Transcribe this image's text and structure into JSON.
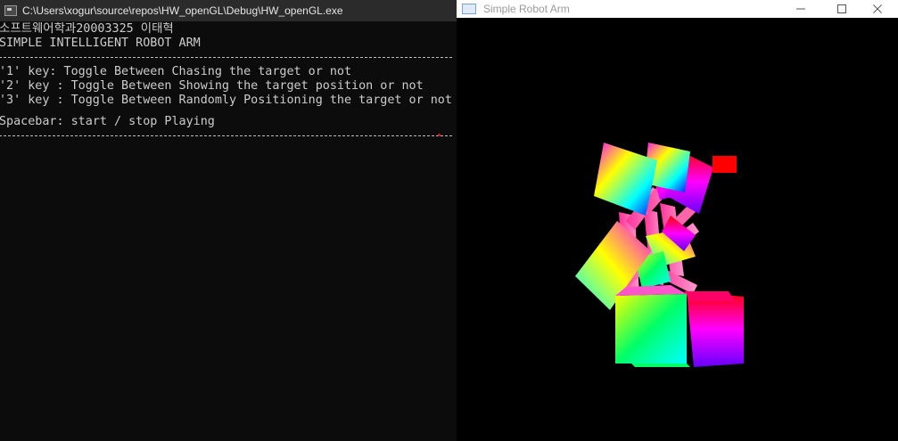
{
  "console": {
    "title": "C:\\Users\\xogur\\source\\repos\\HW_openGL\\Debug\\HW_openGL.exe",
    "lines": {
      "author": "소프트웨어학과20003325 이태혁",
      "heading": "SIMPLE INTELLIGENT ROBOT ARM",
      "key1": "'1' key: Toggle Between Chasing the target or not",
      "key2": "'2' key : Toggle Between Showing the target position or not",
      "key3": "'3' key : Toggle Between Randomly Positioning the target or not",
      "spacebar": "Spacebar: start / stop Playing"
    }
  },
  "gl_window": {
    "title": "Simple Robot Arm",
    "target_color": "#ff0000"
  },
  "icons": {
    "console": "console-app-icon",
    "gl": "window-app-icon",
    "minimize": "minimize-icon",
    "maximize": "maximize-icon",
    "close": "close-icon"
  }
}
